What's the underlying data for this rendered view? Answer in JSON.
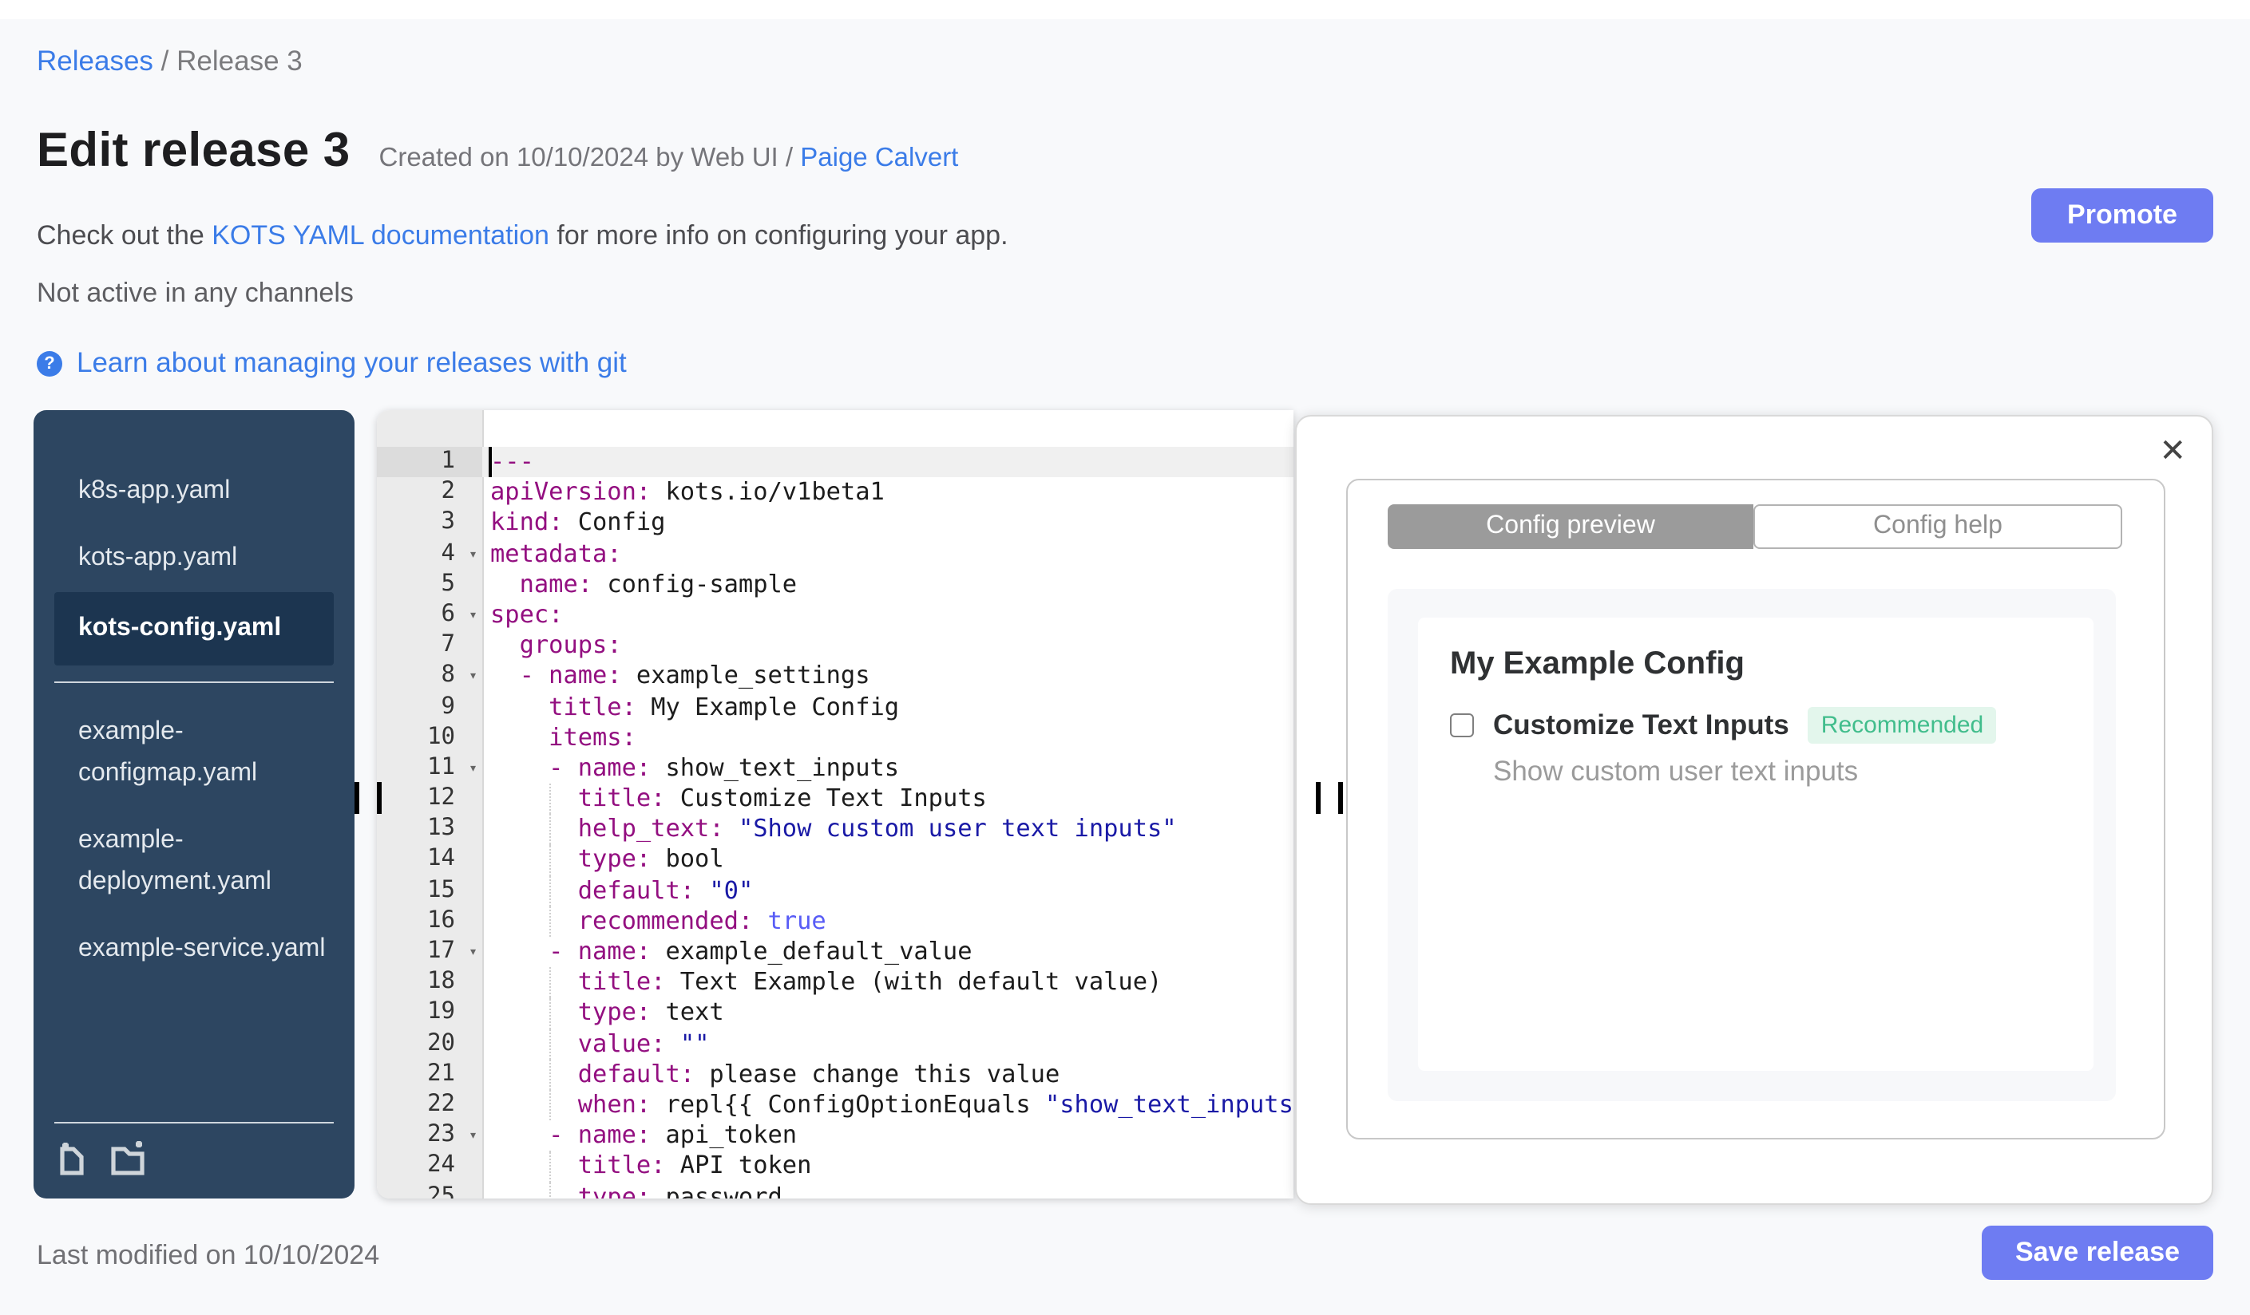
{
  "breadcrumb": {
    "link": "Releases",
    "separator": " / ",
    "current": "Release 3"
  },
  "header": {
    "title": "Edit release 3",
    "created_prefix": "Created on 10/10/2024 by Web UI / ",
    "created_link": "Paige Calvert",
    "docs_prefix": "Check out the ",
    "docs_link": "KOTS YAML documentation",
    "docs_suffix": " for more info on configuring your app.",
    "channels_note": "Not active in any channels",
    "git_link": "Learn about managing your releases with git",
    "question_glyph": "?",
    "promote_label": "Promote"
  },
  "file_tree": {
    "files": [
      "k8s-app.yaml",
      "kots-app.yaml",
      "kots-config.yaml",
      "example-configmap.yaml",
      "example-deployment.yaml",
      "example-service.yaml"
    ],
    "selected": "kots-config.yaml",
    "divider_after_index": 2,
    "icons": [
      "new-file-icon",
      "new-folder-icon"
    ]
  },
  "editor": {
    "active_line": 1,
    "fold_lines": [
      4,
      6,
      8,
      11,
      17,
      23
    ],
    "lines": [
      {
        "n": 1,
        "guide": false,
        "tokens": [
          [
            "key",
            "---"
          ]
        ]
      },
      {
        "n": 2,
        "guide": false,
        "tokens": [
          [
            "key",
            "apiVersion:"
          ],
          [
            "plain",
            " kots.io/v1beta1"
          ]
        ]
      },
      {
        "n": 3,
        "guide": false,
        "tokens": [
          [
            "key",
            "kind:"
          ],
          [
            "plain",
            " Config"
          ]
        ]
      },
      {
        "n": 4,
        "guide": false,
        "tokens": [
          [
            "key",
            "metadata:"
          ]
        ]
      },
      {
        "n": 5,
        "guide": false,
        "tokens": [
          [
            "plain",
            "  "
          ],
          [
            "key",
            "name:"
          ],
          [
            "plain",
            " config-sample"
          ]
        ]
      },
      {
        "n": 6,
        "guide": false,
        "tokens": [
          [
            "key",
            "spec:"
          ]
        ]
      },
      {
        "n": 7,
        "guide": false,
        "tokens": [
          [
            "plain",
            "  "
          ],
          [
            "key",
            "groups:"
          ]
        ]
      },
      {
        "n": 8,
        "guide": false,
        "tokens": [
          [
            "plain",
            "  "
          ],
          [
            "key",
            "- name:"
          ],
          [
            "plain",
            " example_settings"
          ]
        ]
      },
      {
        "n": 9,
        "guide": false,
        "tokens": [
          [
            "plain",
            "    "
          ],
          [
            "key",
            "title:"
          ],
          [
            "plain",
            " My Example Config"
          ]
        ]
      },
      {
        "n": 10,
        "guide": false,
        "tokens": [
          [
            "plain",
            "    "
          ],
          [
            "key",
            "items:"
          ]
        ]
      },
      {
        "n": 11,
        "guide": false,
        "tokens": [
          [
            "plain",
            "    "
          ],
          [
            "key",
            "- name:"
          ],
          [
            "plain",
            " show_text_inputs"
          ]
        ]
      },
      {
        "n": 12,
        "guide": true,
        "tokens": [
          [
            "plain",
            "      "
          ],
          [
            "key",
            "title:"
          ],
          [
            "plain",
            " Customize Text Inputs"
          ]
        ]
      },
      {
        "n": 13,
        "guide": true,
        "tokens": [
          [
            "plain",
            "      "
          ],
          [
            "key",
            "help_text:"
          ],
          [
            "plain",
            " "
          ],
          [
            "string",
            "\"Show custom user text inputs\""
          ]
        ]
      },
      {
        "n": 14,
        "guide": true,
        "tokens": [
          [
            "plain",
            "      "
          ],
          [
            "key",
            "type:"
          ],
          [
            "plain",
            " bool"
          ]
        ]
      },
      {
        "n": 15,
        "guide": true,
        "tokens": [
          [
            "plain",
            "      "
          ],
          [
            "key",
            "default:"
          ],
          [
            "plain",
            " "
          ],
          [
            "string",
            "\"0\""
          ]
        ]
      },
      {
        "n": 16,
        "guide": true,
        "tokens": [
          [
            "plain",
            "      "
          ],
          [
            "key",
            "recommended:"
          ],
          [
            "plain",
            " "
          ],
          [
            "const",
            "true"
          ]
        ]
      },
      {
        "n": 17,
        "guide": false,
        "tokens": [
          [
            "plain",
            "    "
          ],
          [
            "key",
            "- name:"
          ],
          [
            "plain",
            " example_default_value"
          ]
        ]
      },
      {
        "n": 18,
        "guide": true,
        "tokens": [
          [
            "plain",
            "      "
          ],
          [
            "key",
            "title:"
          ],
          [
            "plain",
            " Text Example (with default value)"
          ]
        ]
      },
      {
        "n": 19,
        "guide": true,
        "tokens": [
          [
            "plain",
            "      "
          ],
          [
            "key",
            "type:"
          ],
          [
            "plain",
            " text"
          ]
        ]
      },
      {
        "n": 20,
        "guide": true,
        "tokens": [
          [
            "plain",
            "      "
          ],
          [
            "key",
            "value:"
          ],
          [
            "plain",
            " "
          ],
          [
            "string",
            "\"\""
          ]
        ]
      },
      {
        "n": 21,
        "guide": true,
        "tokens": [
          [
            "plain",
            "      "
          ],
          [
            "key",
            "default:"
          ],
          [
            "plain",
            " please change this value"
          ]
        ]
      },
      {
        "n": 22,
        "guide": true,
        "tokens": [
          [
            "plain",
            "      "
          ],
          [
            "key",
            "when:"
          ],
          [
            "plain",
            " repl{{ ConfigOptionEquals "
          ],
          [
            "string",
            "\"show_text_inputs\""
          ]
        ]
      },
      {
        "n": 23,
        "guide": false,
        "tokens": [
          [
            "plain",
            "    "
          ],
          [
            "key",
            "- name:"
          ],
          [
            "plain",
            " api_token"
          ]
        ]
      },
      {
        "n": 24,
        "guide": true,
        "tokens": [
          [
            "plain",
            "      "
          ],
          [
            "key",
            "title:"
          ],
          [
            "plain",
            " API token"
          ]
        ]
      },
      {
        "n": 25,
        "guide": true,
        "tokens": [
          [
            "plain",
            "      "
          ],
          [
            "key",
            "type:"
          ],
          [
            "plain",
            " password"
          ]
        ]
      }
    ]
  },
  "preview": {
    "close_glyph": "✕",
    "tabs": [
      {
        "label": "Config preview",
        "active": true
      },
      {
        "label": "Config help",
        "active": false
      }
    ],
    "group_title": "My Example Config",
    "item_label": "Customize Text Inputs",
    "badge": "Recommended",
    "checkbox_checked": false,
    "help_text": "Show custom user text inputs"
  },
  "footer": {
    "last_modified": "Last modified on 10/10/2024",
    "save_label": "Save release"
  },
  "colors": {
    "accent_button": "#6e7cf2",
    "link_blue": "#3b7ce8",
    "sidebar_bg": "#2d4661",
    "sidebar_selected_bg": "#1c3550",
    "code_key": "#930f80",
    "code_string": "#1a1aa6",
    "code_const": "#585cf6",
    "badge_green_text": "#41bd8c",
    "badge_green_bg": "#e3f6ec",
    "tab_active_bg": "#9b9b9b"
  }
}
